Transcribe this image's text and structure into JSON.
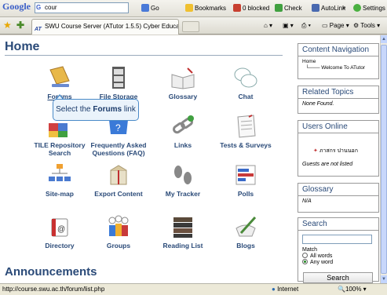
{
  "google_toolbar": {
    "logo": "Google",
    "search_value": "cour",
    "go_label": "Go",
    "bookmarks_label": "Bookmarks",
    "blocked_label": "0 blocked",
    "check_label": "Check",
    "autolink_label": "AutoLink",
    "more_label": "»",
    "settings_label": "Settings"
  },
  "browser": {
    "tab_title": "SWU Course Server (ATutor 1.5.5) Cyber Education :...",
    "favicon_text": "AT",
    "page_menu": "Page",
    "tools_menu": "Tools"
  },
  "page": {
    "title": "Home",
    "tools": [
      {
        "label": "Forums",
        "icon": "forum-icon"
      },
      {
        "label": "File Storage",
        "icon": "file-storage-icon"
      },
      {
        "label": "Glossary",
        "icon": "glossary-icon"
      },
      {
        "label": "Chat",
        "icon": "chat-icon"
      },
      {
        "label": "TILE Repository Search",
        "icon": "tile-repository-icon"
      },
      {
        "label": "Frequently Asked Questions (FAQ)",
        "icon": "faq-icon"
      },
      {
        "label": "Links",
        "icon": "links-icon"
      },
      {
        "label": "Tests & Surveys",
        "icon": "tests-icon"
      },
      {
        "label": "Site-map",
        "icon": "sitemap-icon"
      },
      {
        "label": "Export Content",
        "icon": "export-icon"
      },
      {
        "label": "My Tracker",
        "icon": "tracker-icon"
      },
      {
        "label": "Polls",
        "icon": "polls-icon"
      },
      {
        "label": "Directory",
        "icon": "directory-icon"
      },
      {
        "label": "Groups",
        "icon": "groups-icon"
      },
      {
        "label": "Reading List",
        "icon": "reading-list-icon"
      },
      {
        "label": "Blogs",
        "icon": "blogs-icon"
      }
    ],
    "tooltip_prefix": "Select the ",
    "tooltip_bold": "Forums",
    "tooltip_suffix": " link",
    "announcements": "Announcements"
  },
  "sidebar": {
    "content_nav": {
      "title": "Content Navigation",
      "home": "Home",
      "welcome": "Welcome To ATutor"
    },
    "related": {
      "title": "Related Topics",
      "text": "None Found."
    },
    "users": {
      "title": "Users Online",
      "user": "ภาสกร ปานนอก",
      "guests": "Guests are not listed"
    },
    "glossary": {
      "title": "Glossary",
      "text": "N/A"
    },
    "search": {
      "title": "Search",
      "match": "Match",
      "all_words": "All words",
      "any_word": "Any word",
      "button": "Search"
    }
  },
  "status": {
    "url": "http://course.swu.ac.th/forum/list.php",
    "zone": "Internet",
    "zoom": "100%"
  }
}
